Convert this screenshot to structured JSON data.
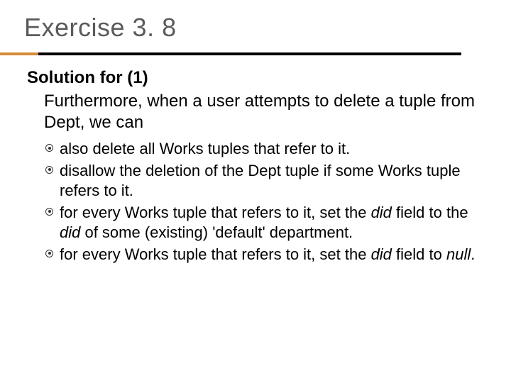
{
  "title": "Exercise 3. 8",
  "subtitle": "Solution for (1)",
  "intro": "Furthermore, when a user attempts to delete a tuple from Dept, we can",
  "bullets": [
    {
      "text_before": "also delete all Works tuples that refer to it.",
      "italic1": "",
      "text_mid": "",
      "italic2": "",
      "text_after": ""
    },
    {
      "text_before": "disallow the deletion of the Dept tuple if some Works tuple refers to it.",
      "italic1": "",
      "text_mid": "",
      "italic2": "",
      "text_after": ""
    },
    {
      "text_before": "for every Works tuple that refers to it, set the ",
      "italic1": "did",
      "text_mid": " field to the ",
      "italic2": "did",
      "text_after": " of some (existing) 'default' department."
    },
    {
      "text_before": "for every Works tuple that refers to it, set the ",
      "italic1": "did",
      "text_mid": " field to ",
      "italic2": "null",
      "text_after": "."
    }
  ]
}
